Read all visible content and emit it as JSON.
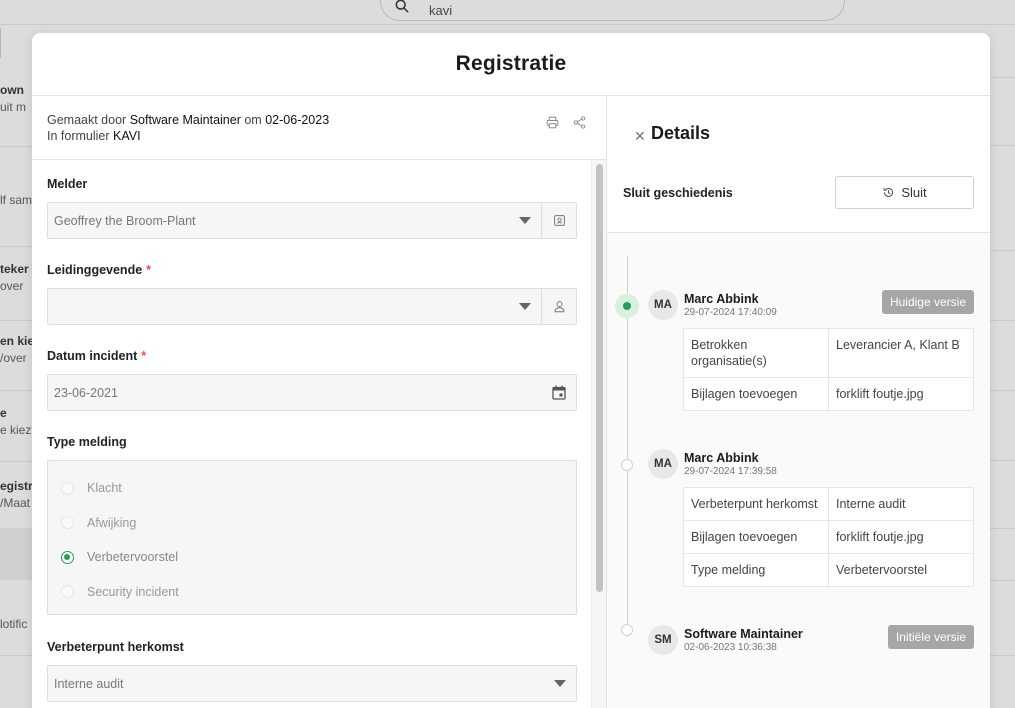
{
  "background": {
    "search_value": "kavi",
    "rows": [
      {
        "title": "own",
        "sub": "uit m"
      },
      {
        "title": "",
        "sub": "lf sam"
      },
      {
        "title": "teker",
        "sub": "over"
      },
      {
        "title": "en kiez",
        "sub": "/over"
      },
      {
        "title": "e",
        "sub": "e kiez"
      },
      {
        "title": "egistra",
        "sub": "/Maat"
      },
      {
        "title": "",
        "sub": "lotific"
      }
    ]
  },
  "modal": {
    "title": "Registratie"
  },
  "meta": {
    "created_by_label": "Gemaakt door",
    "created_by": "Software Maintainer",
    "on_label": "om",
    "created_on": "02-06-2023",
    "form_label": "In formulier",
    "form_name": "KAVI"
  },
  "form": {
    "melder": {
      "label": "Melder",
      "value": "Geoffrey the Broom-Plant"
    },
    "leidinggevende": {
      "label": "Leidinggevende",
      "required": "*",
      "value": ""
    },
    "datum": {
      "label": "Datum incident",
      "required": "*",
      "value": "23-06-2021"
    },
    "type": {
      "label": "Type melding",
      "options": [
        "Klacht",
        "Afwijking",
        "Verbetervoorstel",
        "Security incident"
      ],
      "selected": "Verbetervoorstel"
    },
    "herkomst": {
      "label": "Verbeterpunt herkomst",
      "value": "Interne audit"
    }
  },
  "details": {
    "title": "Details",
    "history_label": "Sluit geschiedenis",
    "close_button": "Sluit",
    "entries": [
      {
        "initials": "MA",
        "name": "Marc Abbink",
        "timestamp": "29-07-2024 17:40:09",
        "badge": "Huidige versie",
        "changes": [
          {
            "field": "Betrokken organisatie(s)",
            "value": "Leverancier A, Klant B"
          },
          {
            "field": "Bijlagen toevoegen",
            "value": "forklift foutje.jpg"
          }
        ]
      },
      {
        "initials": "MA",
        "name": "Marc Abbink",
        "timestamp": "29-07-2024 17:39:58",
        "badge": "",
        "changes": [
          {
            "field": "Verbeterpunt herkomst",
            "value": "Interne audit"
          },
          {
            "field": "Bijlagen toevoegen",
            "value": "forklift foutje.jpg"
          },
          {
            "field": "Type melding",
            "value": "Verbetervoorstel"
          }
        ]
      },
      {
        "initials": "SM",
        "name": "Software Maintainer",
        "timestamp": "02-06-2023 10:36:38",
        "badge": "Initiële versie",
        "changes": []
      }
    ]
  },
  "colors": {
    "accent_green": "#2a9b5b",
    "required_red": "#e8553e",
    "badge_grey": "#a6a6a6"
  }
}
